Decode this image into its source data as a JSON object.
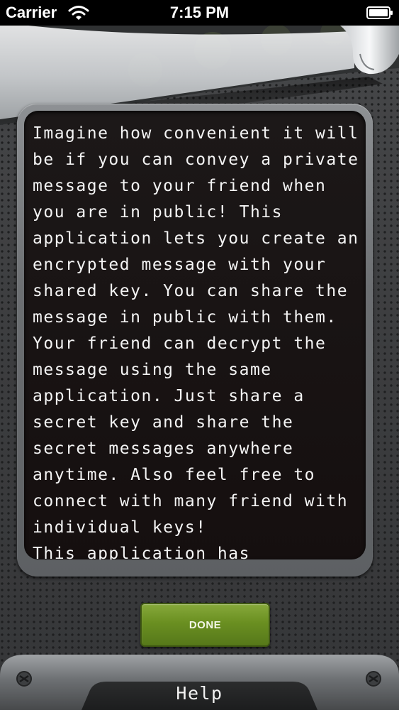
{
  "status_bar": {
    "carrier": "Carrier",
    "time": "7:15 PM",
    "icons": [
      "wifi-icon",
      "battery-icon"
    ]
  },
  "help": {
    "text": "Imagine how convenient it will be if you can convey a private message to your friend when you are in public! This application lets you create an encrypted message with your shared key. You can share the message in public with them. Your friend can decrypt the message using the same application. Just share a secret key and share the secret messages anywhere anytime. Also feel free to connect with many friend with individual keys!\nThis application has"
  },
  "buttons": {
    "done_label": "DONE"
  },
  "bottom_bar": {
    "title": "Help",
    "icons": [
      "screw-icon-left",
      "screw-icon-right"
    ]
  },
  "colors": {
    "background": "#3a3b3c",
    "text_panel": "#150f0f",
    "button_green": "#6a8f21",
    "text": "#f4f4f4"
  }
}
